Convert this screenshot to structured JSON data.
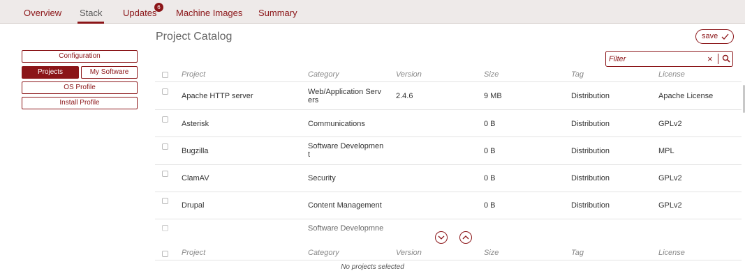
{
  "tabs": [
    {
      "label": "Overview"
    },
    {
      "label": "Stack"
    },
    {
      "label": "Updates"
    },
    {
      "label": "Machine Images"
    },
    {
      "label": "Summary"
    }
  ],
  "updates_badge": "6",
  "sidebar": {
    "configuration": "Configuration",
    "projects": "Projects",
    "my_software": "My Software",
    "os_profile": "OS Profile",
    "install_profile": "Install Profile"
  },
  "main": {
    "title": "Project Catalog",
    "save_label": "save",
    "filter_placeholder": "Filter"
  },
  "columns": [
    "Project",
    "Category",
    "Version",
    "Size",
    "Tag",
    "License"
  ],
  "rows": [
    {
      "project": "Apache HTTP server",
      "category": "Web/Application Serv ers",
      "version": "2.4.6",
      "size": "9 MB",
      "tag": "Distribution",
      "license": "Apache License"
    },
    {
      "project": "Asterisk",
      "category": "Communications",
      "version": "",
      "size": "0 B",
      "tag": "Distribution",
      "license": "GPLv2"
    },
    {
      "project": "Bugzilla",
      "category": "Software Developmen t",
      "version": "",
      "size": "0 B",
      "tag": "Distribution",
      "license": "MPL"
    },
    {
      "project": "ClamAV",
      "category": "Security",
      "version": "",
      "size": "0 B",
      "tag": "Distribution",
      "license": "GPLv2"
    },
    {
      "project": "Drupal",
      "category": "Content Management",
      "version": "",
      "size": "0 B",
      "tag": "Distribution",
      "license": "GPLv2"
    },
    {
      "project": "",
      "category": "Software Developmne",
      "version": "",
      "size": "",
      "tag": "",
      "license": ""
    }
  ],
  "selected_empty_text": "No projects selected",
  "colors": {
    "accent": "#8b1518",
    "topbar": "#eeeae9"
  },
  "icons": [
    "check-icon",
    "close-icon",
    "search-icon",
    "chevron-down-icon",
    "chevron-up-icon"
  ]
}
